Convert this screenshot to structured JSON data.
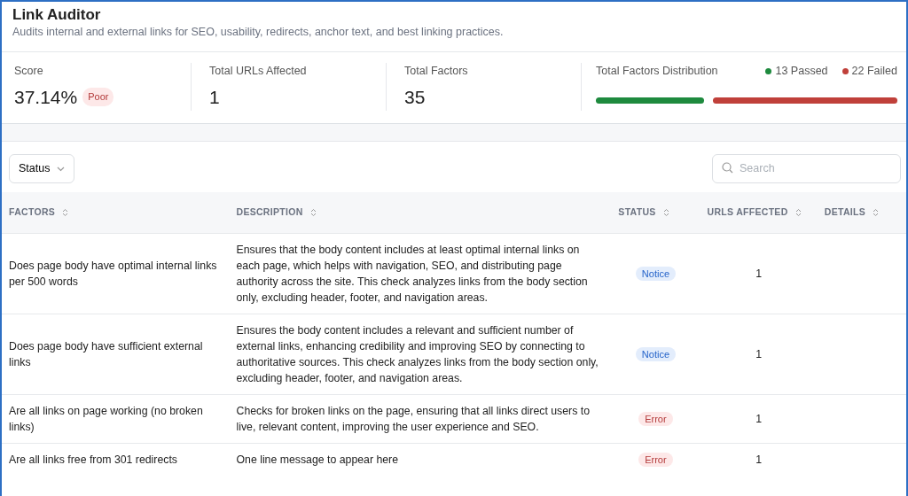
{
  "header": {
    "title": "Link Auditor",
    "subtitle": "Audits internal and external links for SEO, usability, redirects, anchor text, and best linking practices."
  },
  "stats": [
    {
      "label": "Score",
      "value": "37.14%",
      "badge": "Poor"
    },
    {
      "label": "Total URLs Affected",
      "value": "1"
    },
    {
      "label": "Total Factors",
      "value": "35"
    }
  ],
  "distribution": {
    "label": "Total Factors Distribution",
    "passed": "13 Passed",
    "failed": "22 Failed"
  },
  "filter": {
    "label": "Status"
  },
  "search": {
    "placeholder": "Search"
  },
  "table": {
    "columns": [
      "FACTORS",
      "DESCRIPTION",
      "STATUS",
      "URLS AFFECTED",
      "DETAILS"
    ],
    "rows": [
      {
        "factor": "Does page body have optimal internal links per 500 words",
        "description": "Ensures that the body content includes at least optimal internal links on each page, which helps with navigation, SEO, and distributing page authority across the site. This check analyzes links from the body section only, excluding header, footer, and navigation areas.",
        "status": "Notice",
        "kind": "notice",
        "urls": "1"
      },
      {
        "factor": "Does page body have sufficient external links",
        "description": "Ensures the body content includes a relevant and sufficient number of external links, enhancing credibility and improving SEO by connecting to authoritative sources. This check analyzes links from the body section only, excluding header, footer, and navigation areas.",
        "status": "Notice",
        "kind": "notice",
        "urls": "1"
      },
      {
        "factor": "Are all links on page working (no broken links)",
        "description": "Checks for broken links on the page, ensuring that all links direct users to live, relevant content, improving the user experience and SEO.",
        "status": "Error",
        "kind": "error",
        "urls": "1"
      },
      {
        "factor": "Are all links free from 301 redirects",
        "description": "One line message to appear here",
        "status": "Error",
        "kind": "error",
        "urls": "1"
      }
    ]
  }
}
